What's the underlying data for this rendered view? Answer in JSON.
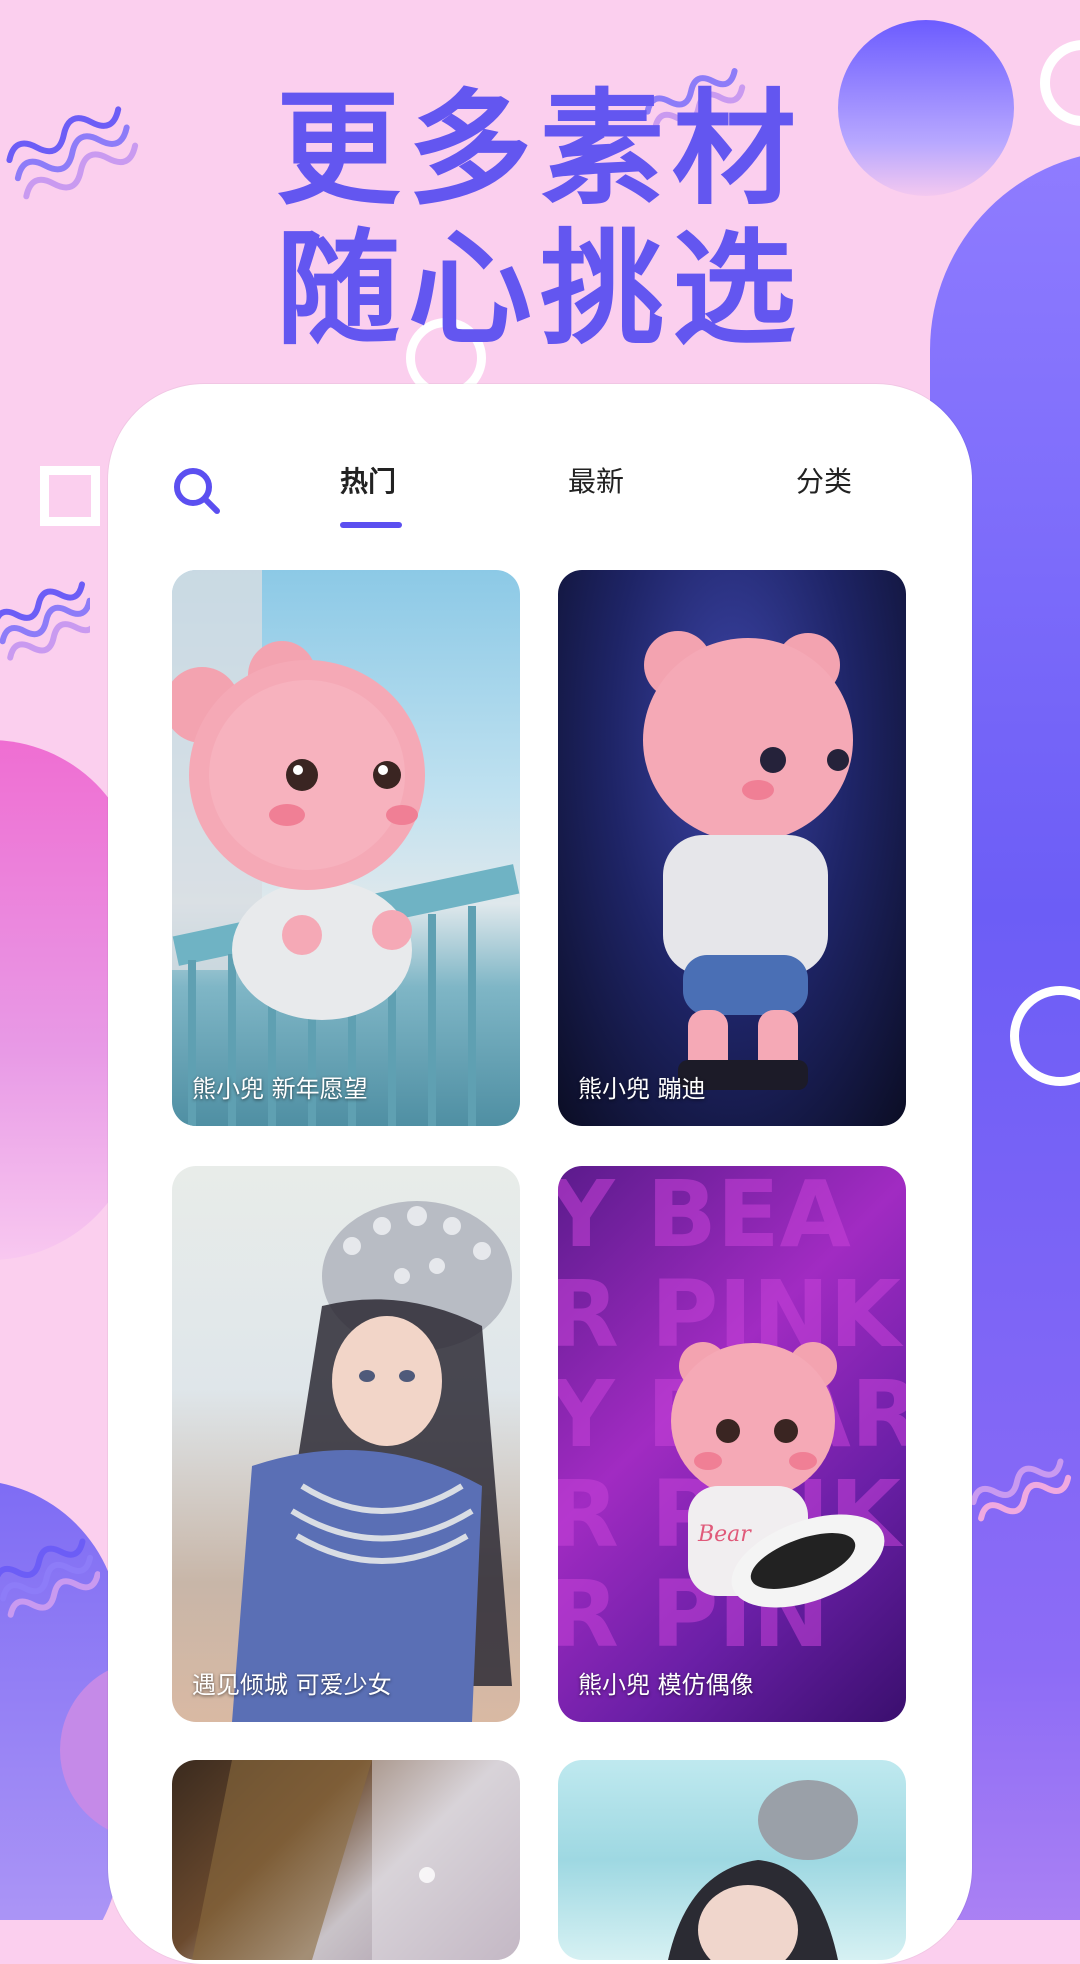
{
  "headline": {
    "line1": "更多素材",
    "line2": "随心挑选"
  },
  "tabs": {
    "search_icon": "search-icon",
    "items": [
      {
        "label": "热门",
        "active": true
      },
      {
        "label": "最新",
        "active": false
      },
      {
        "label": "分类",
        "active": false
      }
    ]
  },
  "cards": [
    {
      "caption": "熊小兜 新年愿望"
    },
    {
      "caption": "熊小兜 蹦迪"
    },
    {
      "caption": "遇见倾城 可爱少女"
    },
    {
      "caption": "熊小兜 模仿偶像"
    }
  ],
  "colors": {
    "accent": "#5b4ff0",
    "headline": "#6356f0",
    "background": "#fbcfee"
  }
}
